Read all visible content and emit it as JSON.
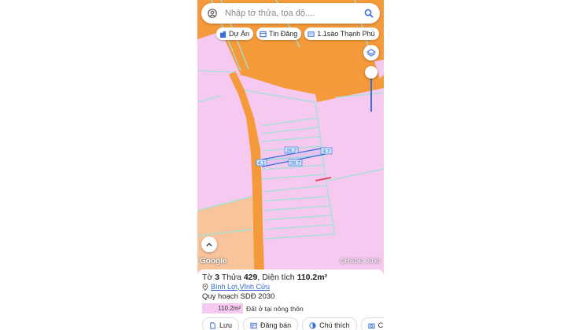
{
  "search": {
    "placeholder": "Nhập tờ thửa, tọa độ...."
  },
  "chips": [
    {
      "label": "Dự Án",
      "icon": "building-icon"
    },
    {
      "label": "Tin Đăng",
      "icon": "listing-icon"
    },
    {
      "label": "1.1sào Thạnh Phú",
      "icon": "card-icon"
    }
  ],
  "map": {
    "google_label": "Google",
    "plan_label": "QHSDĐ 2030",
    "dimensions": [
      "26.2",
      "4.7",
      "4.1",
      "26.7"
    ],
    "colors": {
      "residential": "#f6c9f0",
      "road": "#f59a3a",
      "agricultural": "#f8c49c",
      "parcel_line": "#9fe3d6",
      "selected": "#2f6fd6"
    }
  },
  "parcel": {
    "title_prefix": "Tờ ",
    "sheet": "3",
    "title_mid": " Thửa ",
    "lot": "429",
    "title_area_prefix": ", Diện tích ",
    "area": "110.2m²",
    "location": {
      "commune": "Bình Lợi",
      "separator": ", ",
      "district": "Vĩnh Cửu"
    },
    "plan_title": "Quy hoạch SDĐ 2030",
    "plan_area": "110.2m²",
    "plan_type": "Đất ở tại nông thôn"
  },
  "actions": [
    {
      "label": "Lưu",
      "icon": "file-icon"
    },
    {
      "label": "Đăng bán",
      "icon": "table-icon"
    },
    {
      "label": "Chú thích",
      "icon": "contrast-icon"
    },
    {
      "label": "C",
      "icon": "camera-icon"
    }
  ]
}
